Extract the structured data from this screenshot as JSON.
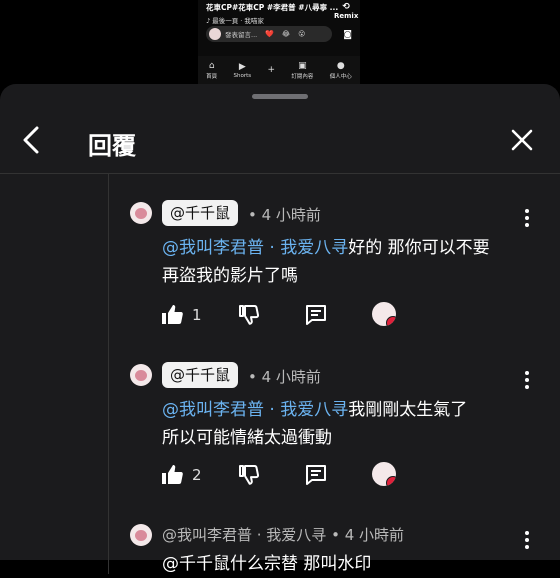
{
  "video": {
    "tags": "花車CP#花車CP #李君普 #八尋寧 ...",
    "remix_label": "Remix",
    "music": "最後一頁 · 我喵家",
    "comment_placeholder": "發表留言...",
    "emojis": [
      "❤️",
      "😂",
      "😮"
    ],
    "nav": [
      {
        "icon": "home-icon",
        "label": "首頁"
      },
      {
        "icon": "shorts-icon",
        "label": "Shorts"
      },
      {
        "icon": "plus-icon",
        "label": ""
      },
      {
        "icon": "subscriptions-icon",
        "label": "訂閱內容"
      },
      {
        "icon": "profile-icon",
        "label": "個人中心"
      }
    ]
  },
  "sheet": {
    "title": "回覆"
  },
  "replies": [
    {
      "chip": "@千千鼠",
      "meta": "• 4 小時前",
      "mention": "@我叫李君普 · 我爱八寻",
      "text_line1": "好的 那你可以不要",
      "text_line2": "再盜我的影片了嗎",
      "likes": "1"
    },
    {
      "chip": "@千千鼠",
      "meta": "• 4 小時前",
      "mention": "@我叫李君普 · 我爱八寻",
      "text_line1": "我剛剛太生氣了",
      "text_line2": "所以可能情緒太過衝動",
      "likes": "2"
    },
    {
      "meta": "@我叫李君普 · 我爱八寻 • 4 小時前",
      "text_line1": "@千千鼠什么宗替 那叫水印"
    }
  ],
  "colors": {
    "mention": "#6bb3f0",
    "sheet_bg": "#1b1b1d",
    "heart": "#e0203a"
  }
}
